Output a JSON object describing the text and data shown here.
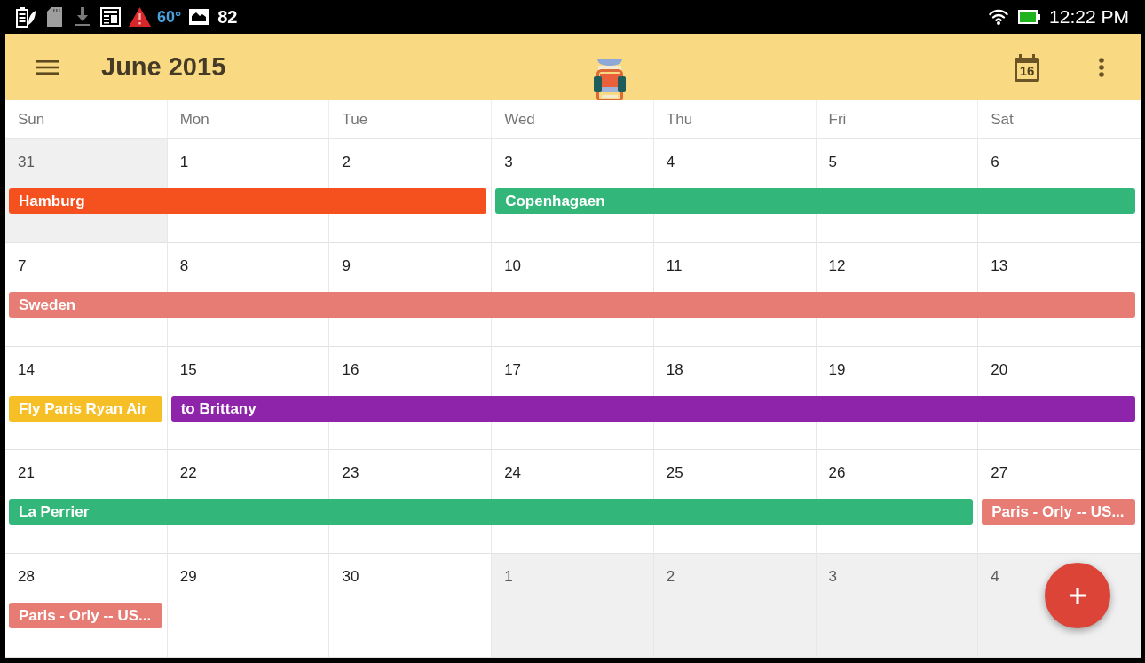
{
  "status_bar": {
    "temperature": "60°",
    "notification_count": "82",
    "time": "12:22 PM"
  },
  "app_bar": {
    "title": "June 2015",
    "today_label": "16"
  },
  "calendar": {
    "weekdays": [
      "Sun",
      "Mon",
      "Tue",
      "Wed",
      "Thu",
      "Fri",
      "Sat"
    ],
    "weeks": [
      {
        "days": [
          {
            "label": "31",
            "in_month": false,
            "event": {
              "kind": "start",
              "title": "Hamburg",
              "color": "#f4511e"
            }
          },
          {
            "label": "1",
            "in_month": true,
            "event": {
              "kind": "continued"
            }
          },
          {
            "label": "2",
            "in_month": true,
            "event": {
              "kind": "continued"
            }
          },
          {
            "label": "3",
            "in_month": true,
            "event": {
              "kind": "start",
              "title": "Copenhagaen",
              "color": "#33b679"
            }
          },
          {
            "label": "4",
            "in_month": true,
            "event": {
              "kind": "continued"
            }
          },
          {
            "label": "5",
            "in_month": true,
            "event": {
              "kind": "continued"
            }
          },
          {
            "label": "6",
            "in_month": true,
            "event": {
              "kind": "continued"
            }
          }
        ]
      },
      {
        "days": [
          {
            "label": "7",
            "in_month": true,
            "event": {
              "kind": "start",
              "title": "Sweden",
              "color": "#e67c73"
            }
          },
          {
            "label": "8",
            "in_month": true,
            "event": {
              "kind": "continued"
            }
          },
          {
            "label": "9",
            "in_month": true,
            "event": {
              "kind": "continued"
            }
          },
          {
            "label": "10",
            "in_month": true,
            "event": {
              "kind": "continued"
            }
          },
          {
            "label": "11",
            "in_month": true,
            "event": {
              "kind": "continued"
            }
          },
          {
            "label": "12",
            "in_month": true,
            "event": {
              "kind": "continued"
            }
          },
          {
            "label": "13",
            "in_month": true,
            "event": {
              "kind": "continued"
            }
          }
        ]
      },
      {
        "days": [
          {
            "label": "14",
            "in_month": true,
            "event": {
              "kind": "start",
              "title": "Fly Paris Ryan Air",
              "color": "#f6bf26"
            }
          },
          {
            "label": "15",
            "in_month": true,
            "event": {
              "kind": "start",
              "title": "to Brittany",
              "color": "#8e24aa"
            }
          },
          {
            "label": "16",
            "in_month": true,
            "event": {
              "kind": "continued"
            }
          },
          {
            "label": "17",
            "in_month": true,
            "event": {
              "kind": "continued"
            }
          },
          {
            "label": "18",
            "in_month": true,
            "event": {
              "kind": "continued"
            }
          },
          {
            "label": "19",
            "in_month": true,
            "event": {
              "kind": "continued"
            }
          },
          {
            "label": "20",
            "in_month": true,
            "event": {
              "kind": "continued"
            }
          }
        ]
      },
      {
        "days": [
          {
            "label": "21",
            "in_month": true,
            "event": {
              "kind": "start",
              "title": "La Perrier",
              "color": "#33b679"
            }
          },
          {
            "label": "22",
            "in_month": true,
            "event": {
              "kind": "continued"
            }
          },
          {
            "label": "23",
            "in_month": true,
            "event": {
              "kind": "continued"
            }
          },
          {
            "label": "24",
            "in_month": true,
            "event": {
              "kind": "continued"
            }
          },
          {
            "label": "25",
            "in_month": true,
            "event": {
              "kind": "continued"
            }
          },
          {
            "label": "26",
            "in_month": true,
            "event": {
              "kind": "continued"
            }
          },
          {
            "label": "27",
            "in_month": true,
            "event": {
              "kind": "start",
              "title": "Paris - Orly -- US...",
              "color": "#e67c73"
            }
          }
        ]
      },
      {
        "days": [
          {
            "label": "28",
            "in_month": true,
            "event": {
              "kind": "start",
              "title": "Paris - Orly -- US...",
              "color": "#e67c73"
            }
          },
          {
            "label": "29",
            "in_month": true
          },
          {
            "label": "30",
            "in_month": true
          },
          {
            "label": "1",
            "in_month": false
          },
          {
            "label": "2",
            "in_month": false
          },
          {
            "label": "3",
            "in_month": false
          },
          {
            "label": "4",
            "in_month": false
          }
        ]
      }
    ]
  }
}
